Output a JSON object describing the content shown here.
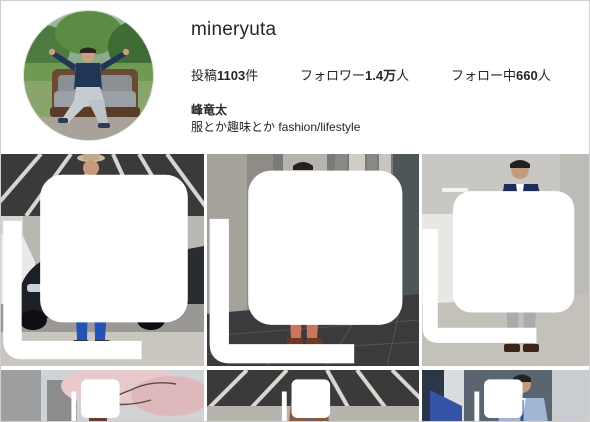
{
  "profile": {
    "username": "mineryuta",
    "posts_label": "投稿",
    "posts_count": "1103",
    "posts_unit": "件",
    "followers_label": "フォロワー",
    "followers_count": "1.4万",
    "followers_unit": "人",
    "following_label": "フォロー中",
    "following_count": "660",
    "following_unit": "人",
    "display_name": "峰竜太",
    "bio": "服とか趣味とか fashion/lifestyle"
  },
  "posts": [
    {
      "id": 1,
      "icon": "multiple-images-icon",
      "subject": "blue suit, black car"
    },
    {
      "id": 2,
      "icon": "multiple-images-icon",
      "subject": "salmon suit, tall columns"
    },
    {
      "id": 3,
      "icon": "multiple-images-icon",
      "subject": "navy blazer, grey trousers"
    },
    {
      "id": 4,
      "icon": "multiple-images-icon",
      "subject": "cherry blossoms"
    },
    {
      "id": 5,
      "icon": "multiple-images-icon",
      "subject": "brown jacket, striped ceiling"
    },
    {
      "id": 6,
      "icon": "multiple-images-icon",
      "subject": "light blue jacket"
    }
  ],
  "colors": {
    "text": "#262626",
    "border": "#cfcfcf",
    "tile_icon": "#ffffff"
  }
}
